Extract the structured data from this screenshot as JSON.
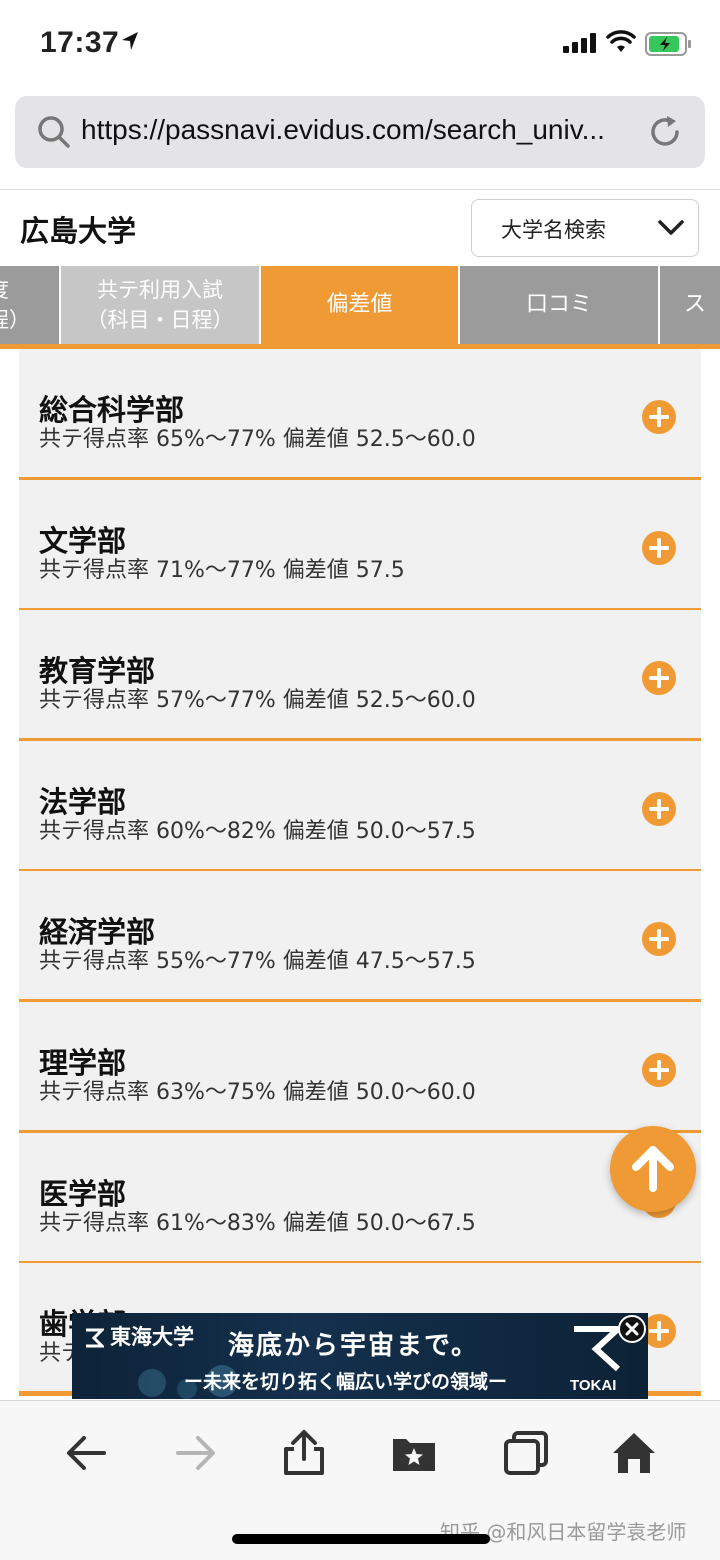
{
  "status_bar": {
    "time": "17:37"
  },
  "url_bar": {
    "url": "https://passnavi.evidus.com/search_univ..."
  },
  "header": {
    "title": "広島大学",
    "search_dropdown": "大学名検索"
  },
  "tabs": [
    {
      "line1": "度",
      "line2": "程）"
    },
    {
      "line1": "共テ利用入試",
      "line2": "（科目・日程）"
    },
    {
      "label": "偏差値",
      "active": true
    },
    {
      "label": "口コミ"
    },
    {
      "label": "ス"
    }
  ],
  "faculties": [
    {
      "name": "総合科学部",
      "info": "共テ得点率 65%〜77% 偏差値 52.5〜60.0"
    },
    {
      "name": "文学部",
      "info": "共テ得点率 71%〜77% 偏差値 57.5"
    },
    {
      "name": "教育学部",
      "info": "共テ得点率 57%〜77% 偏差値 52.5〜60.0"
    },
    {
      "name": "法学部",
      "info": "共テ得点率 60%〜82% 偏差値 50.0〜57.5"
    },
    {
      "name": "経済学部",
      "info": "共テ得点率 55%〜77% 偏差値 47.5〜57.5"
    },
    {
      "name": "理学部",
      "info": "共テ得点率 63%〜75% 偏差値 50.0〜60.0"
    },
    {
      "name": "医学部",
      "info": "共テ得点率 61%〜83% 偏差値 50.0〜67.5"
    },
    {
      "name": "歯学部",
      "info": "共テ"
    }
  ],
  "ad": {
    "logo": "東海大学",
    "headline": "海底から宇宙まで。",
    "subline": "ー未来を切り拓く幅広い学びの領域ー",
    "brand": "TOKAI"
  },
  "watermark": "知乎 @和风日本留学袁老师",
  "colors": {
    "accent": "#ef9a34",
    "tab_inactive": "#9b9b9b",
    "card_bg": "#f1f1f1"
  },
  "icons": [
    "location-arrow-icon",
    "signal-icon",
    "wifi-icon",
    "battery-icon",
    "search-icon",
    "reload-icon",
    "chevron-down-icon",
    "plus-circle-icon",
    "arrow-up-icon",
    "close-icon",
    "back-icon",
    "forward-icon",
    "share-icon",
    "bookmarks-icon",
    "tabs-icon",
    "home-icon"
  ]
}
